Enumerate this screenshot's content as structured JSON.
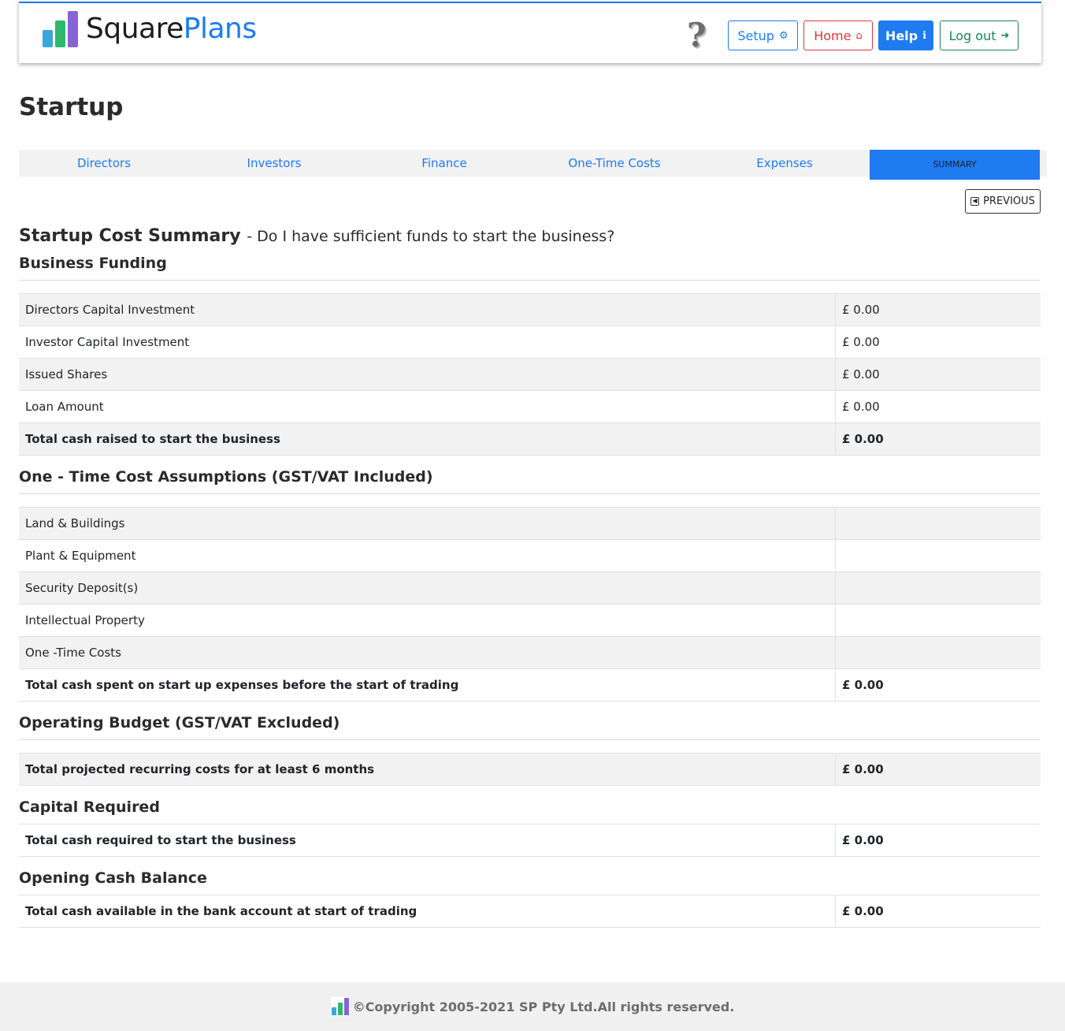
{
  "header": {
    "logo_part1": "Square",
    "logo_part2": "Plans",
    "help_glyph": "?",
    "buttons": {
      "setup": "Setup",
      "home": "Home",
      "help": "Help",
      "logout": "Log out"
    }
  },
  "colors": {
    "accent": "#1e7bf0",
    "danger": "#dc3545",
    "success": "#198754",
    "logo_bar_1": "#3aa6e0",
    "logo_bar_2": "#2fb86a",
    "logo_bar_3": "#8a63d2"
  },
  "page_title": "Startup",
  "tabs": [
    "Directors",
    "Investors",
    "Finance",
    "One-Time Costs",
    "Expenses",
    "SUMMARY"
  ],
  "previous_label": "PREVIOUS",
  "summary": {
    "title": "Startup Cost Summary",
    "subtitle": "- Do I have sufficient funds to start the business?"
  },
  "business_funding": {
    "title": "Business Funding",
    "rows": [
      {
        "label": "Directors Capital Investment",
        "value": "£ 0.00"
      },
      {
        "label": "Investor Capital Investment",
        "value": "£ 0.00"
      },
      {
        "label": "Issued Shares",
        "value": "£ 0.00"
      },
      {
        "label": "Loan Amount",
        "value": "£ 0.00"
      },
      {
        "label": "Total cash raised to start the business",
        "value": "£ 0.00"
      }
    ]
  },
  "one_time": {
    "title": "One - Time Cost Assumptions (GST/VAT Included)",
    "rows": [
      {
        "label": "Land & Buildings",
        "value": ""
      },
      {
        "label": "Plant & Equipment",
        "value": ""
      },
      {
        "label": "Security Deposit(s)",
        "value": ""
      },
      {
        "label": "Intellectual Property",
        "value": ""
      },
      {
        "label": "One -Time Costs",
        "value": ""
      },
      {
        "label": "Total cash spent on start up expenses before the start of trading",
        "value": "£ 0.00"
      }
    ]
  },
  "operating_budget": {
    "title": "Operating Budget (GST/VAT Excluded)",
    "rows": [
      {
        "label": "Total projected recurring costs for at least 6 months",
        "value": "£ 0.00"
      }
    ]
  },
  "capital_required": {
    "title": "Capital Required",
    "rows": [
      {
        "label": "Total cash required to start the business",
        "value": "£ 0.00"
      }
    ]
  },
  "opening_cash": {
    "title": "Opening Cash Balance",
    "rows": [
      {
        "label": "Total cash available in the bank account at start of trading",
        "value": "£ 0.00"
      }
    ]
  },
  "footer": {
    "copyright": "©Copyright 2005-2021 SP Pty Ltd.All rights reserved."
  }
}
